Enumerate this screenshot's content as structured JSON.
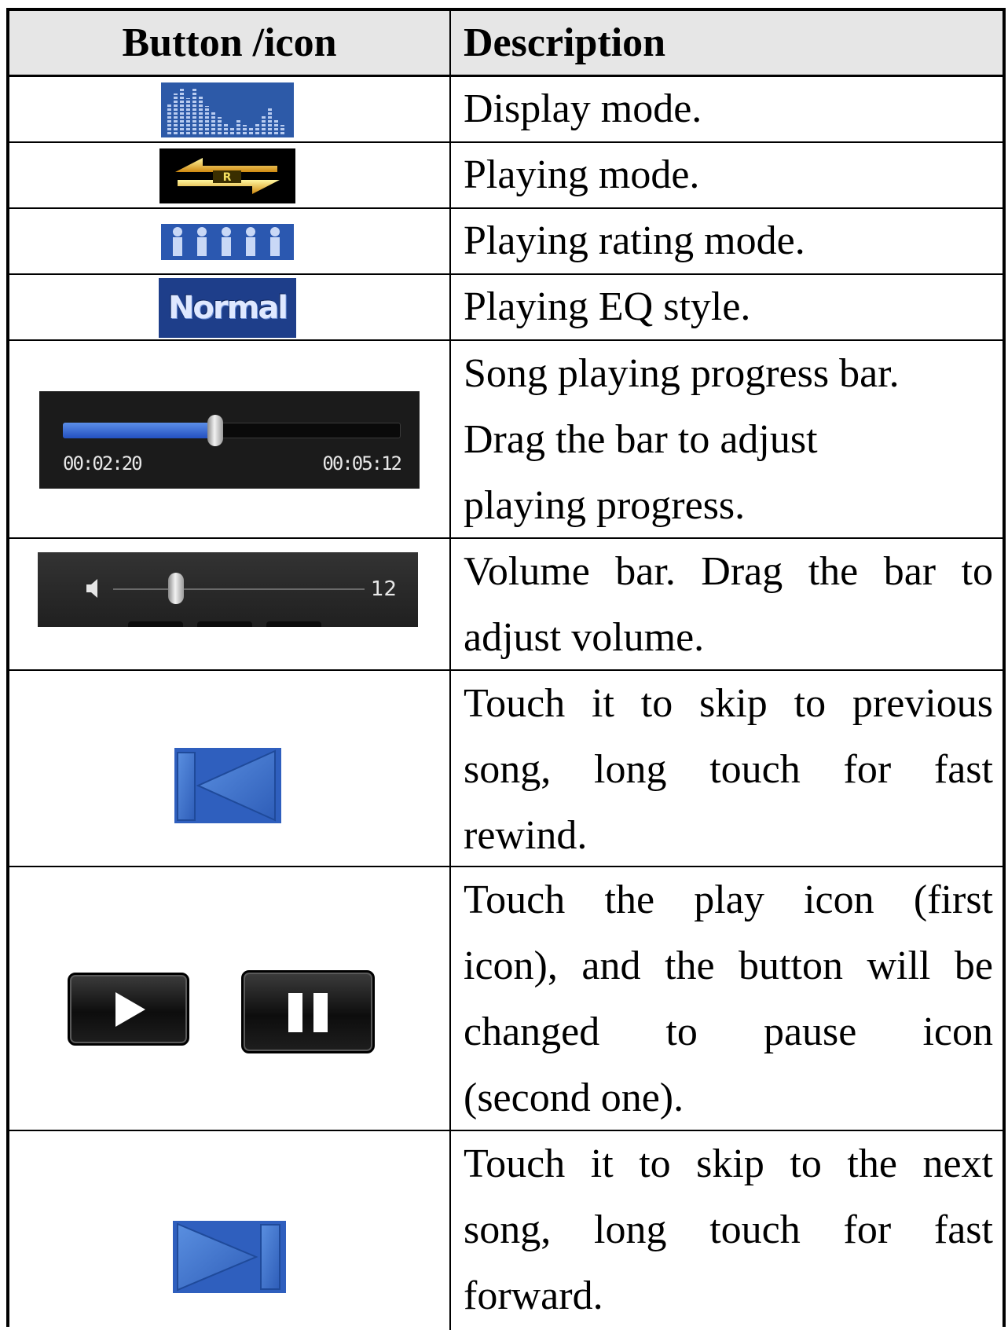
{
  "header": {
    "col1": "Button /icon",
    "col2": "Description"
  },
  "rows": [
    {
      "icon": "display-mode-icon",
      "desc": [
        "Display mode."
      ]
    },
    {
      "icon": "playing-mode-icon",
      "desc": [
        "Playing mode."
      ]
    },
    {
      "icon": "rating-mode-icon",
      "desc": [
        "Playing rating mode."
      ]
    },
    {
      "icon": "eq-style-icon",
      "eq_label": "Normal",
      "desc": [
        "Playing EQ style."
      ]
    },
    {
      "icon": "progress-bar-icon",
      "current_time": "00:02:20",
      "total_time": "00:05:12",
      "progress": 0.45,
      "desc": [
        "Song playing progress bar.",
        "Drag the bar to adjust",
        "playing progress."
      ]
    },
    {
      "icon": "volume-bar-icon",
      "volume_value": "12",
      "volume_level": 0.25,
      "desc": [
        "Volume bar. Drag the bar to",
        "adjust volume."
      ]
    },
    {
      "icon": "previous-icon",
      "desc": [
        "Touch it to skip to previous",
        "song, long touch for fast",
        "rewind."
      ]
    },
    {
      "icon": "play-pause-icons",
      "desc": [
        "Touch the play icon (first",
        "icon), and the button will be",
        "changed to pause icon",
        "(second one)."
      ]
    },
    {
      "icon": "next-icon",
      "desc": [
        "Touch it to skip to the next",
        "song, long touch for fast",
        "forward."
      ]
    }
  ],
  "colors": {
    "icon_blue": "#2d5aa8",
    "bar_blue": "#2f62d6",
    "panel_dark": "#1b1b1b"
  }
}
